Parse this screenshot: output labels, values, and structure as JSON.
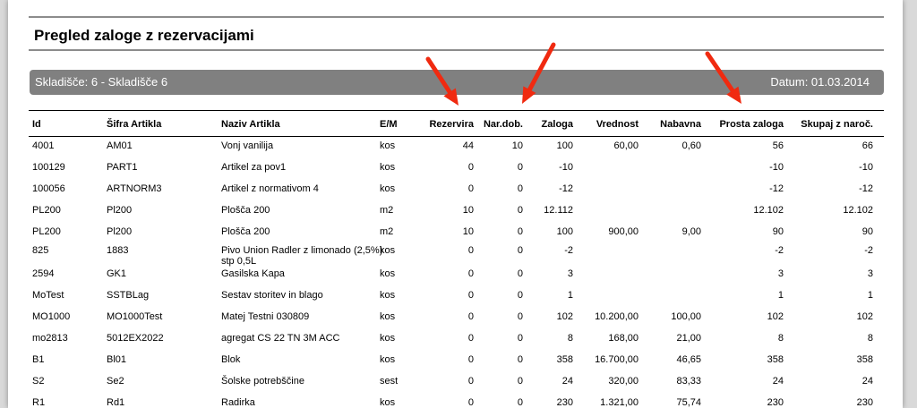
{
  "report": {
    "title": "Pregled zaloge z rezervacijami",
    "warehouse": "Skladišče: 6 - Skladišče 6",
    "date": "Datum: 01.03.2014"
  },
  "columns": [
    "Id",
    "Šifra Artikla",
    "Naziv Artikla",
    "E/M",
    "Rezervira",
    "Nar.dob.",
    "Zaloga",
    "Vrednost",
    "Nabavna",
    "Prosta zaloga",
    "Skupaj z naroč."
  ],
  "rows": [
    [
      "4001",
      "AM01",
      "Vonj vanilija",
      "kos",
      "44",
      "10",
      "100",
      "60,00",
      "0,60",
      "56",
      "66"
    ],
    [
      "100129",
      "PART1",
      "Artikel za pov1",
      "kos",
      "0",
      "0",
      "-10",
      "",
      "",
      "-10",
      "-10"
    ],
    [
      "100056",
      "ARTNORM3",
      "Artikel z normativom 4",
      "kos",
      "0",
      "0",
      "-12",
      "",
      "",
      "-12",
      "-12"
    ],
    [
      "PL200",
      "Pl200",
      "Plošča 200",
      "m2",
      "10",
      "0",
      "12.112",
      "",
      "",
      "12.102",
      "12.102"
    ],
    [
      "PL200",
      "Pl200",
      "Plošča 200",
      "m2",
      "10",
      "0",
      "100",
      "900,00",
      "9,00",
      "90",
      "90"
    ],
    [
      "825",
      "1883",
      "Pivo Union Radler z limonado (2,5%) stp 0,5L",
      "kos",
      "0",
      "0",
      "-2",
      "",
      "",
      "-2",
      "-2"
    ],
    [
      "2594",
      "GK1",
      "Gasilska Kapa",
      "kos",
      "0",
      "0",
      "3",
      "",
      "",
      "3",
      "3"
    ],
    [
      "MoTest",
      "SSTBLag",
      "Sestav storitev in blago",
      "kos",
      "0",
      "0",
      "1",
      "",
      "",
      "1",
      "1"
    ],
    [
      "MO1000",
      "MO1000Test",
      "Matej Testni 030809",
      "kos",
      "0",
      "0",
      "102",
      "10.200,00",
      "100,00",
      "102",
      "102"
    ],
    [
      "mo2813",
      "5012EX2022",
      "agregat CS 22 TN 3M ACC",
      "kos",
      "0",
      "0",
      "8",
      "168,00",
      "21,00",
      "8",
      "8"
    ],
    [
      "B1",
      "Bl01",
      "Blok",
      "kos",
      "0",
      "0",
      "358",
      "16.700,00",
      "46,65",
      "358",
      "358"
    ],
    [
      "S2",
      "Se2",
      "Šolske potrebščine",
      "sest",
      "0",
      "0",
      "24",
      "320,00",
      "83,33",
      "24",
      "24"
    ],
    [
      "R1",
      "Rd1",
      "Radirka",
      "kos",
      "0",
      "0",
      "230",
      "1.321,00",
      "75,74",
      "230",
      "230"
    ]
  ],
  "colors": {
    "band": "#808080",
    "arrow": "#f02a10",
    "rule": "#8c8c8c"
  },
  "annotations": [
    "arrow-icon",
    "arrow-icon",
    "arrow-icon"
  ]
}
